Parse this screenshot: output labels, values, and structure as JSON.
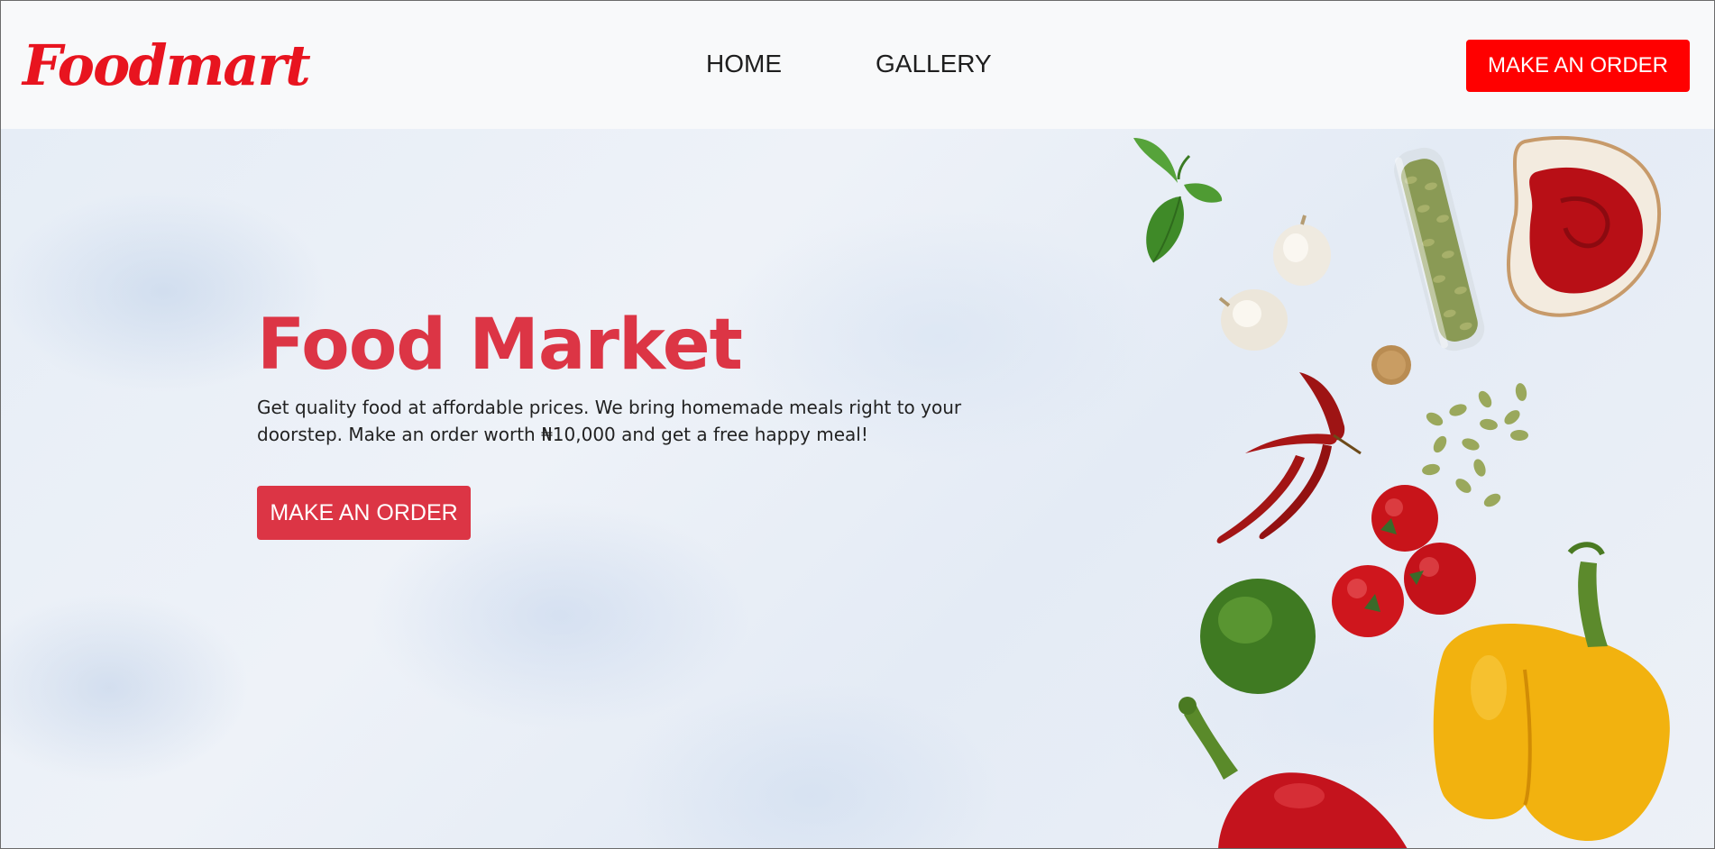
{
  "navbar": {
    "logo": "Foodmart",
    "links": [
      {
        "label": "HOME"
      },
      {
        "label": "GALLERY"
      }
    ],
    "order_button": "MAKE AN ORDER"
  },
  "hero": {
    "title": "Food Market",
    "description": "Get quality food at affordable prices. We bring homemade meals right to your doorstep. Make an order worth ₦10,000 and get a free happy meal!",
    "order_button": "MAKE AN ORDER"
  },
  "theme": {
    "logo_color": "#e8141f",
    "nav_button_color": "#ff0000",
    "hero_accent": "#dc3545",
    "navbar_background": "#f8f9fa"
  },
  "decor_items": [
    "basil-leaf",
    "garlic-bulb",
    "pumpkin-seeds-jar",
    "ketchup-bowl",
    "cork",
    "dried-chili-peppers",
    "pumpkin-seeds",
    "cherry-tomatoes",
    "lime",
    "yellow-bell-pepper",
    "red-bell-pepper"
  ]
}
